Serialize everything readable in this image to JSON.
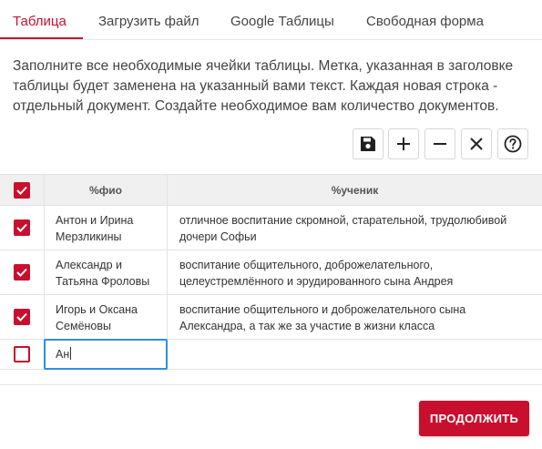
{
  "tabs": [
    {
      "label": "Таблица",
      "active": true
    },
    {
      "label": "Загрузить файл"
    },
    {
      "label": "Google Таблицы"
    },
    {
      "label": "Свободная форма"
    }
  ],
  "description": "Заполните все необходимые ячейки таблицы. Метка, указанная в заголовке таблицы будет заменена на указанный вами текст. Каждая новая строка - отдельный документ. Создайте необходимое вам количество документов.",
  "toolbar": {
    "buttons": [
      {
        "icon": "save-icon"
      },
      {
        "icon": "plus-icon"
      },
      {
        "icon": "minus-icon"
      },
      {
        "icon": "close-icon"
      },
      {
        "icon": "help-icon"
      }
    ]
  },
  "table": {
    "header": {
      "col1": "%фио",
      "col2": "%ученик",
      "all_checked": true
    },
    "rows": [
      {
        "checked": true,
        "fio": "Антон и Ирина Мерзликины",
        "uchenik": "отличное воспитание скромной, старательной, трудолюбивой дочери Софьи"
      },
      {
        "checked": true,
        "fio": "Александр и Татьяна Фроловы",
        "uchenik": "воспитание общительного, доброжелательного, целеустремлённого и эрудированного сына Андрея"
      },
      {
        "checked": true,
        "fio": "Игорь и Оксана Семёновы",
        "uchenik": "воспитание общительного и доброжелательного сына Александра, а так же за участие в жизни класса"
      },
      {
        "checked": false,
        "fio": "Ан",
        "uchenik": ""
      }
    ]
  },
  "continue_label": "ПРОДОЛЖИТЬ",
  "colors": {
    "accent": "#c8102e",
    "focus": "#2d8fe6"
  }
}
